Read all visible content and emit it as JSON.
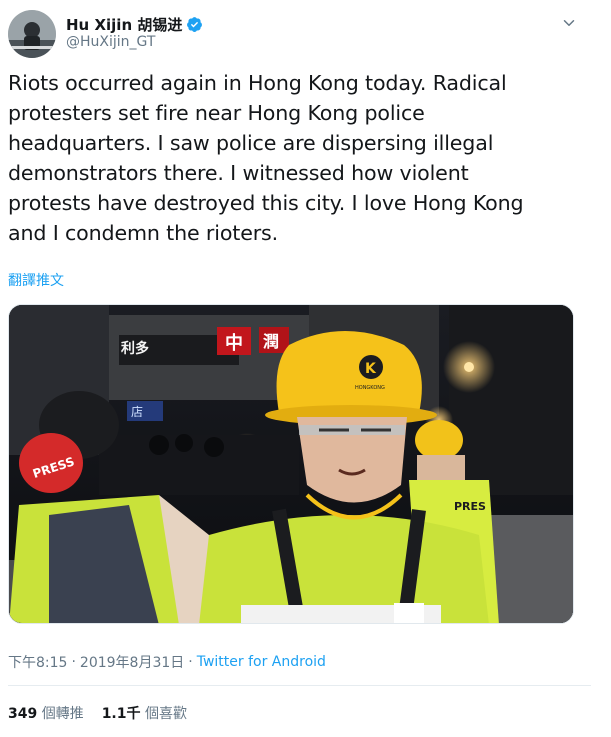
{
  "author": {
    "display_name": "Hu Xijin 胡锡进",
    "handle": "@HuXijin_GT",
    "verified": true
  },
  "tweet": {
    "text_lines": [
      "Riots occurred again in Hong Kong today. Radical",
      "protesters set fire near Hong Kong police",
      "headquarters. I saw police are dispersing illegal",
      "demonstrators there. I witnessed how violent",
      "protests have destroyed this city. I love Hong Kong",
      "and I condemn the rioters."
    ],
    "translate_label": "翻譯推文"
  },
  "media": {
    "signs": [
      "利多",
      "中",
      "潤",
      "店"
    ],
    "helmet_logo": "K",
    "helmet_text": "HONGKONG",
    "vest_texts": [
      "PRESS",
      "PRES"
    ]
  },
  "meta": {
    "time": "下午8:15",
    "separator": "·",
    "date": "2019年8月31日",
    "separator2": "·",
    "source": "Twitter for Android"
  },
  "stats": {
    "retweets_count": "349",
    "retweets_label": "個轉推",
    "likes_count": "1.1千",
    "likes_label": "個喜歡"
  },
  "colors": {
    "accent": "#1da1f2",
    "muted": "#657786",
    "text": "#14171a",
    "helmet": "#f5c21a",
    "vest": "#c8e63a"
  },
  "icons": {
    "verified": "verified-badge-icon",
    "caret": "chevron-down-icon"
  }
}
